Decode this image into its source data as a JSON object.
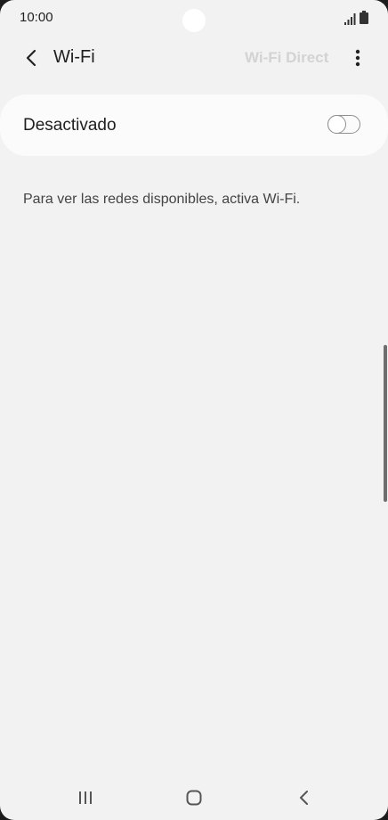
{
  "status_bar": {
    "time": "10:00",
    "icons": [
      "signal-icon",
      "battery-icon"
    ]
  },
  "app_bar": {
    "title": "Wi-Fi",
    "wifi_direct_label": "Wi-Fi Direct",
    "back_icon": "chevron-left-icon",
    "more_icon": "more-vertical-icon"
  },
  "wifi_toggle": {
    "label": "Desactivado",
    "state": "off"
  },
  "info": {
    "message": "Para ver las redes disponibles, activa Wi-Fi."
  },
  "nav_bar": {
    "icons": [
      "recents-icon",
      "home-icon",
      "back-icon"
    ]
  },
  "colors": {
    "background": "#f2f2f2",
    "card": "#fbfbfb",
    "text": "#1f1f1f",
    "disabled_text": "#d3d3d3"
  }
}
